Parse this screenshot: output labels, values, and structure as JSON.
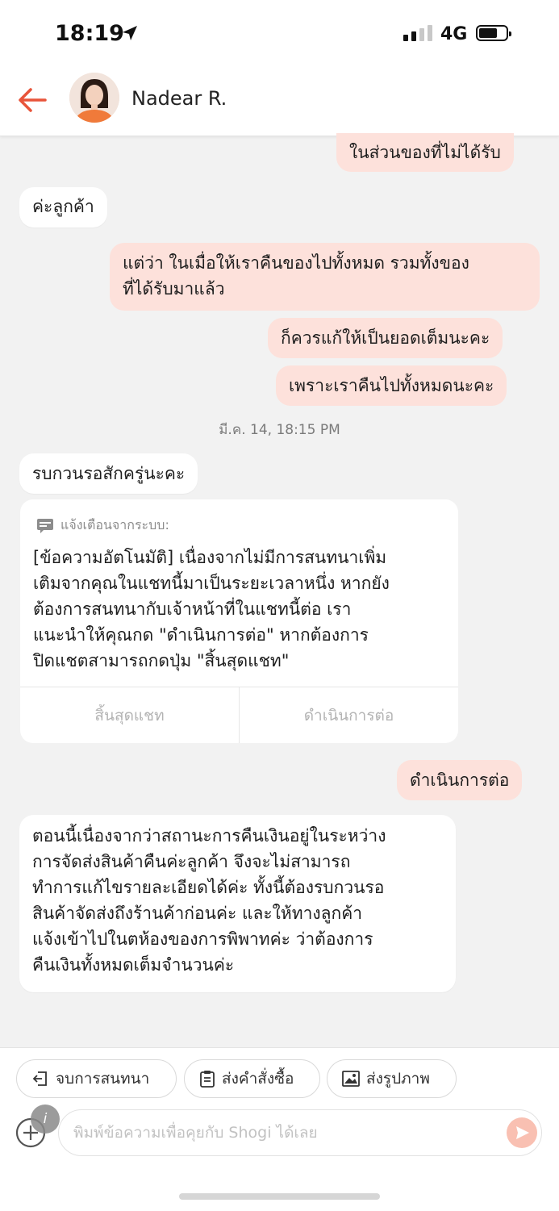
{
  "status_bar": {
    "time": "18:19",
    "network": "4G",
    "location_icon": "location-arrow-icon",
    "signal_bars": 2
  },
  "header": {
    "contact_name": "Nadear R.",
    "back_icon": "back-arrow-icon",
    "accent_color": "#e8543a"
  },
  "messages": {
    "m1": "ในส่วนของที่ไม่ได้รับ",
    "m2": "ค่ะลูกค้า",
    "m3_line1": "แต่ว่า ในเมื่อให้เราคืนของไปทั้งหมด รวมทั้งของ",
    "m3_line2": "ที่ได้รับมาแล้ว",
    "m4": "ก็ควรแก้ให้เป็นยอดเต็มนะคะ",
    "m5": "เพราะเราคืนไปทั้งหมดนะคะ",
    "timestamp": "มี.ค. 14, 18:15 PM",
    "m6": "รบกวนรอสักครู่นะคะ",
    "m7": "ดำเนินการต่อ",
    "m8_lines": [
      "ตอนนี้เนื่องจากว่าสถานะการคืนเงินอยู่ในระหว่าง",
      "การจัดส่งสินค้าคืนค่ะลูกค้า จึงจะไม่สามารถ",
      "ทำการแก้ไขรายละเอียดได้ค่ะ ทั้งนี้ต้องรบกวนรอ",
      "สินค้าจัดส่งถึงร้านค้าก่อนค่ะ และให้ทางลูกค้า",
      "แจ้งเข้าไปในตห้องของการพิพาทค่ะ ว่าต้องการ",
      "คืนเงินทั้งหมดเต็มจำนวนค่ะ"
    ]
  },
  "system_card": {
    "header": "แจ้งเตือนจากระบบ:",
    "lines": [
      "[ข้อความอัตโนมัติ] เนื่องจากไม่มีการสนทนาเพิ่ม",
      "เติมจากคุณในแชทนี้มาเป็นระยะเวลาหนึ่ง หากยัง",
      "ต้องการสนทนากับเจ้าหน้าที่ในแชทนี้ต่อ เรา",
      "แนะนำให้คุณกด \"ดำเนินการต่อ\" หากต้องการ",
      "ปิดแชตสามารถกดปุ่ม \"สิ้นสุดแชท\""
    ],
    "end_chat_label": "สิ้นสุดแชท",
    "continue_label": "ดำเนินการต่อ"
  },
  "quick_actions": {
    "end_chat": "จบการสนทนา",
    "send_order": "ส่งคำสั่งซื้อ",
    "send_image": "ส่งรูปภาพ"
  },
  "composer": {
    "placeholder": "พิมพ์ข้อความเพื่อคุยกับ Shogi ได้เลย",
    "value": "",
    "info_label": "i"
  },
  "colors": {
    "outgoing_bubble": "#fde1db",
    "incoming_bubble": "#ffffff",
    "background": "#f2f2f2"
  }
}
